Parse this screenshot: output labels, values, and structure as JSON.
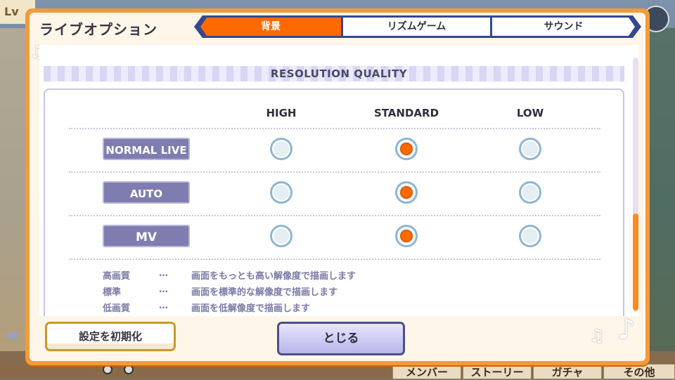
{
  "background": {
    "lv_label": "Lv",
    "nav_left": "«",
    "menu": [
      "メンバー",
      "ストーリー",
      "ガチャ",
      "その他"
    ]
  },
  "dialog": {
    "title": "ライブオプション",
    "tabs": [
      {
        "label": "背景",
        "active": true
      },
      {
        "label": "リズムゲーム",
        "active": false
      },
      {
        "label": "サウンド",
        "active": false
      }
    ],
    "section_title": "RESOLUTION QUALITY",
    "columns": [
      "HIGH",
      "STANDARD",
      "LOW"
    ],
    "rows": [
      {
        "label": "NORMAL LIVE",
        "selected": "STANDARD"
      },
      {
        "label": "AUTO",
        "selected": "STANDARD"
      },
      {
        "label": "MV",
        "selected": "STANDARD"
      }
    ],
    "legend": [
      {
        "term": "高画質",
        "dots": "…",
        "desc": "画面をもっとも高い解像度で描画します"
      },
      {
        "term": "標準",
        "dots": "…",
        "desc": "画面を標準的な解像度で描画します"
      },
      {
        "term": "低画質",
        "dots": "…",
        "desc": "画面を低解像度で描画します"
      }
    ],
    "reset_button": "設定を初期化",
    "close_button": "とじる"
  },
  "colors": {
    "accent": "#ff6a00",
    "frame": "#f39a3c",
    "tab_bar": "#33488e",
    "label_bg": "#7f7db0"
  },
  "icons": [
    "music-note-icon",
    "radio-icon",
    "scrollbar"
  ]
}
